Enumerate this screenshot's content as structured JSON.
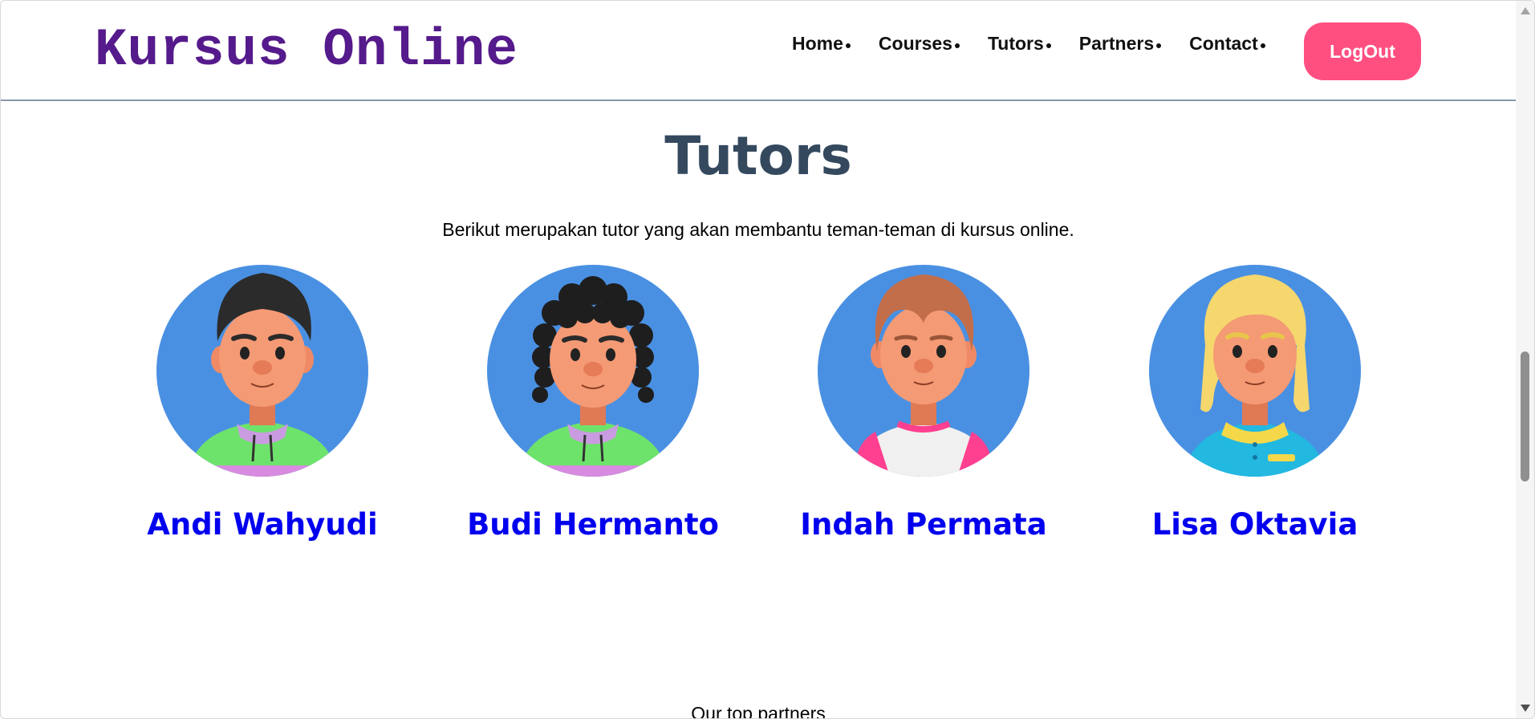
{
  "header": {
    "logo": "Kursus Online",
    "nav": [
      {
        "label": "Home"
      },
      {
        "label": "Courses"
      },
      {
        "label": "Tutors"
      },
      {
        "label": "Partners"
      },
      {
        "label": "Contact"
      }
    ],
    "logout_label": "LogOut"
  },
  "main": {
    "title": "Tutors",
    "subtitle": "Berikut merupakan tutor yang akan membantu teman-teman di kursus online.",
    "tutors": [
      {
        "name": "Andi Wahyudi",
        "icon": "avatar-boy-wavy-hair"
      },
      {
        "name": "Budi Hermanto",
        "icon": "avatar-boy-curly-hair"
      },
      {
        "name": "Indah Permata",
        "icon": "avatar-auburn-hair"
      },
      {
        "name": "Lisa Oktavia",
        "icon": "avatar-blonde-hair"
      }
    ],
    "partners_heading": "Our top partners"
  },
  "colors": {
    "logo": "#551a8b",
    "accent": "#ff4f81",
    "avatar_bg": "#4a90e2",
    "link": "#0000ee",
    "title": "#34495e"
  }
}
